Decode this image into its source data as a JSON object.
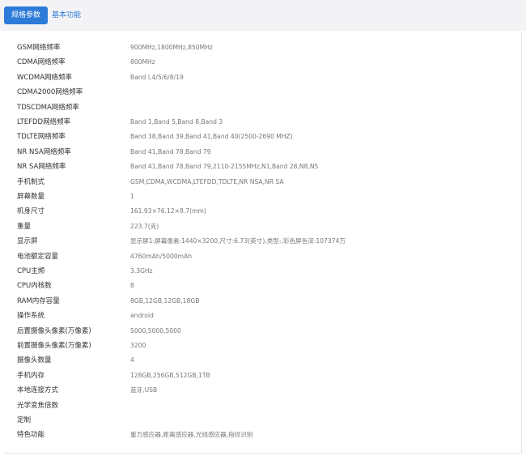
{
  "tabs": {
    "active": "规格参数",
    "other": "基本功能"
  },
  "specs": [
    {
      "label": "GSM网络频率",
      "value": "900MHz,1800MHz,850MHz"
    },
    {
      "label": "CDMA网络频率",
      "value": "800MHz"
    },
    {
      "label": "WCDMA网络频率",
      "value": "Band Ⅰ,4/5/6/8/19"
    },
    {
      "label": "CDMA2000网络频率",
      "value": ""
    },
    {
      "label": "TDSCDMA网络频率",
      "value": ""
    },
    {
      "label": "LTEFDD网络频率",
      "value": "Band 1,Band 5,Band 8,Band 3"
    },
    {
      "label": "TDLTE网络频率",
      "value": "Band 38,Band 39,Band 41,Band 40(2500-2690 MHZ)"
    },
    {
      "label": "NR NSA网络频率",
      "value": "Band 41,Band 78,Band 79"
    },
    {
      "label": "NR SA网络频率",
      "value": "Band 41,Band 78,Band 79,2110-2155MHz,N1,Band 28,N8,N5"
    },
    {
      "label": "手机制式",
      "value": "GSM,CDMA,WCDMA,LTEFDD,TDLTE,NR NSA,NR SA"
    },
    {
      "label": "屏幕数量",
      "value": "1"
    },
    {
      "label": "机身尺寸",
      "value": "161.93×76.12×8.7(mm)"
    },
    {
      "label": "重量",
      "value": "223.7(克)"
    },
    {
      "label": "显示屏",
      "value": "显示屏1:屏幕像素:1440×3200,尺寸:6.73(英寸),类型:,彩色屏色深:107374万"
    },
    {
      "label": "电池额定容量",
      "value": "4760mAh/5000mAh"
    },
    {
      "label": "CPU主频",
      "value": "3.3GHz"
    },
    {
      "label": "CPU内核数",
      "value": "8"
    },
    {
      "label": "RAM内存容量",
      "value": "8GB,12GB,12GB,18GB"
    },
    {
      "label": "操作系统",
      "value": "android"
    },
    {
      "label": "后置摄像头像素(万像素)",
      "value": "5000,5000,5000"
    },
    {
      "label": "前置摄像头像素(万像素)",
      "value": "3200"
    },
    {
      "label": "摄像头数量",
      "value": "4"
    },
    {
      "label": "手机内存",
      "value": "128GB,256GB,512GB,1TB"
    },
    {
      "label": "本地连接方式",
      "value": "蓝牙,USB"
    },
    {
      "label": "光学变焦倍数",
      "value": ""
    },
    {
      "label": "定制",
      "value": ""
    },
    {
      "label": "特色功能",
      "value": "重力感应器,距离感应器,光线感应器,指纹识别"
    }
  ]
}
